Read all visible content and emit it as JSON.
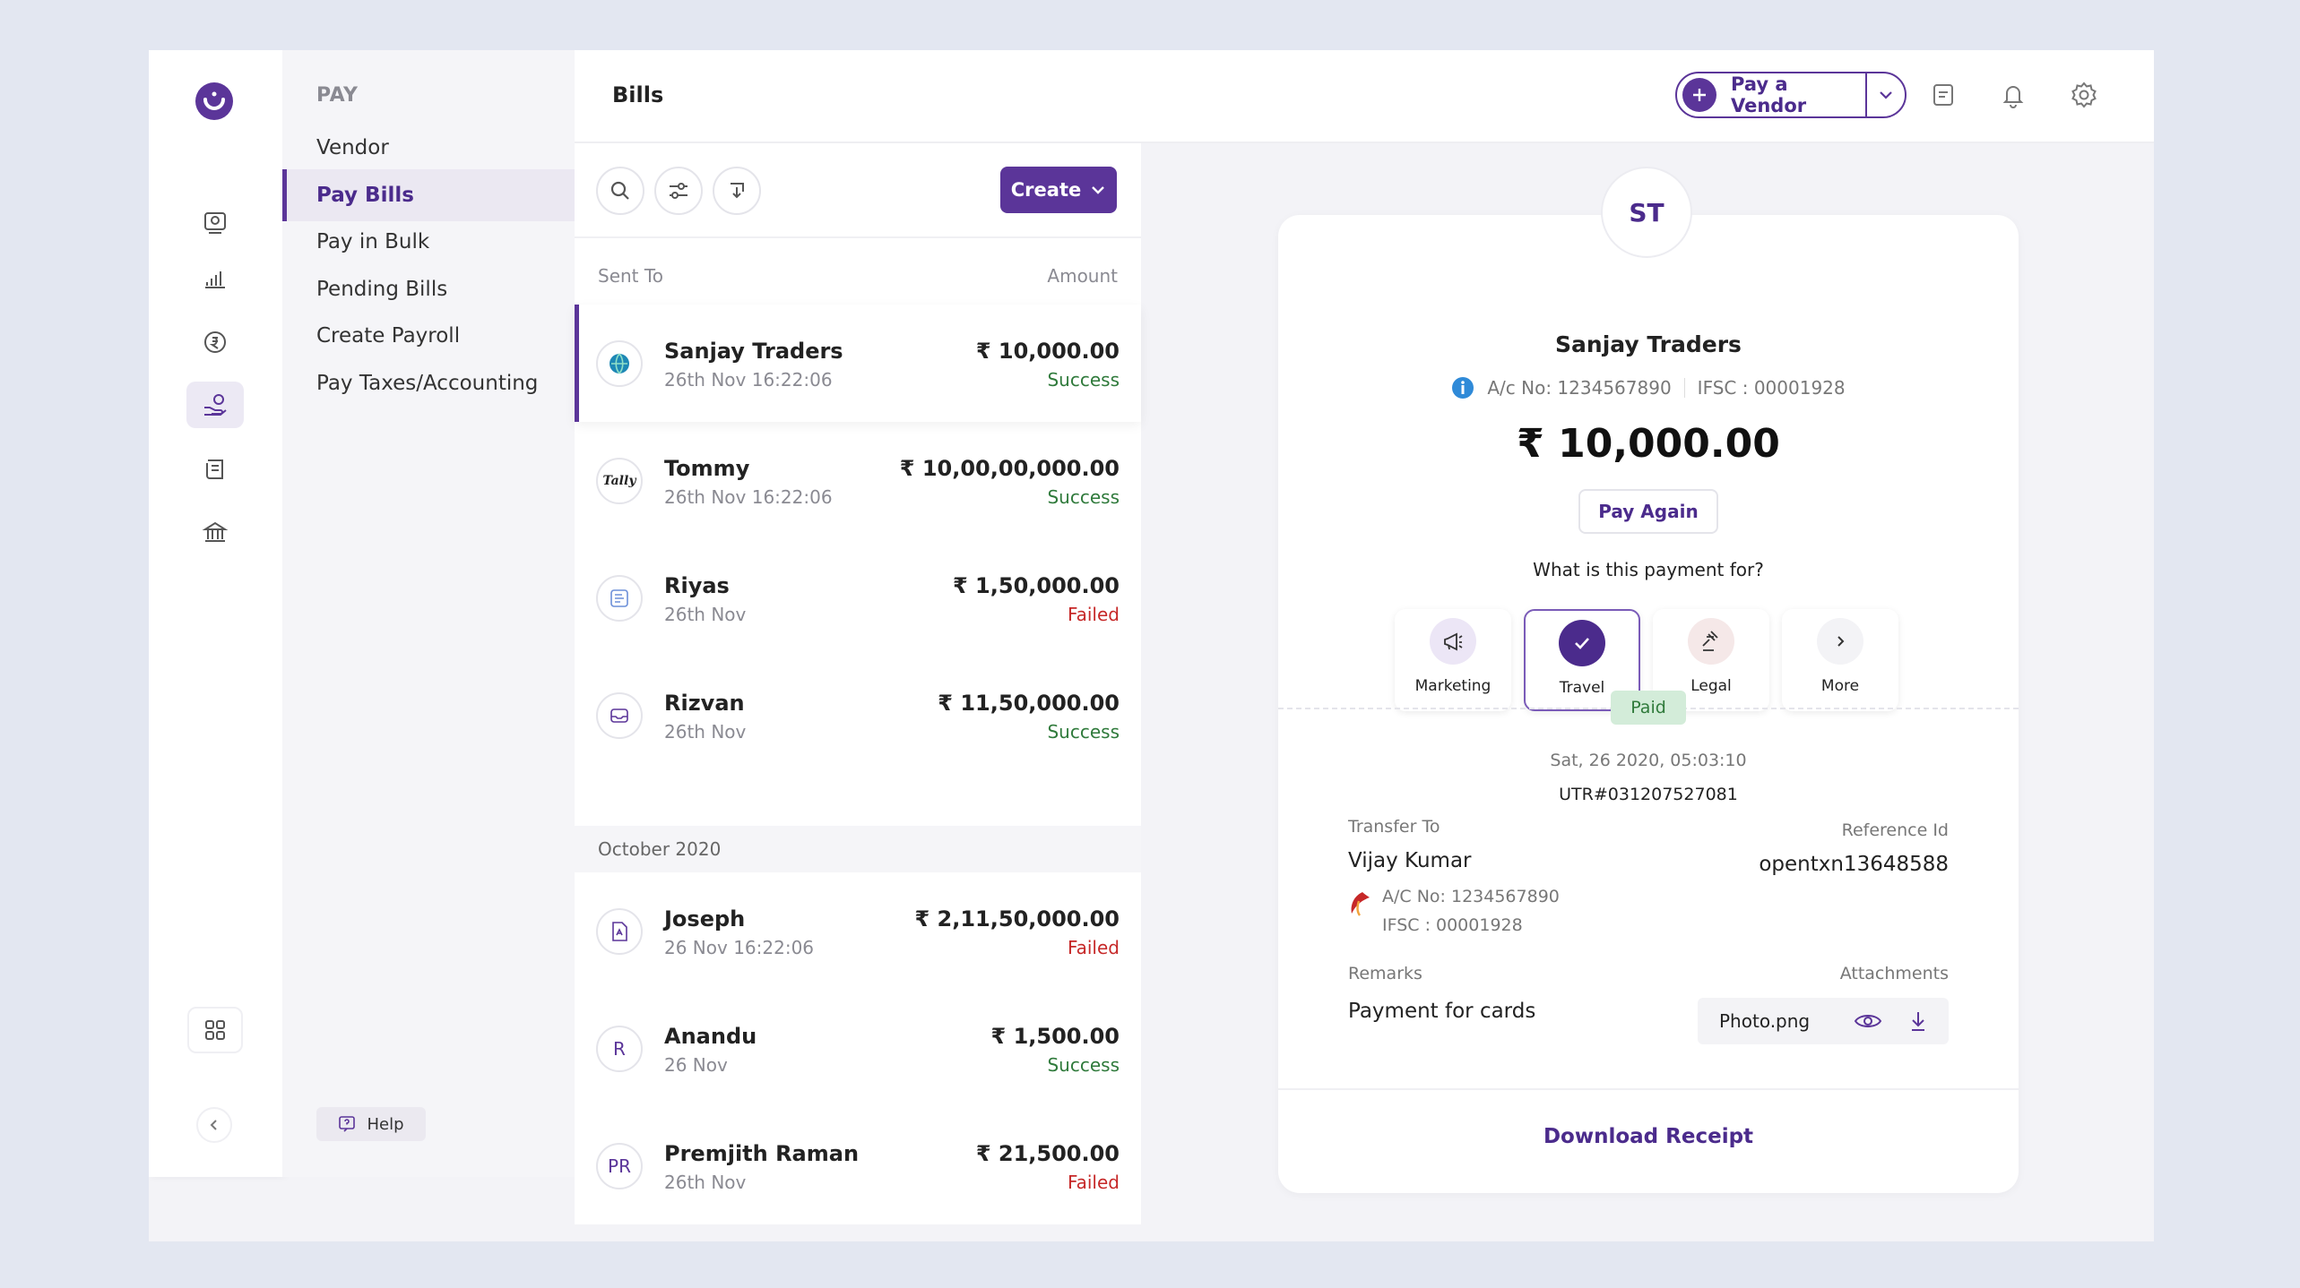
{
  "topbar": {
    "title": "Bills",
    "pay_vendor_label": "Pay a Vendor"
  },
  "menu": {
    "heading": "PAY",
    "items": [
      {
        "label": "Vendor"
      },
      {
        "label": "Pay Bills"
      },
      {
        "label": "Pay in Bulk"
      },
      {
        "label": "Pending Bills"
      },
      {
        "label": "Create Payroll"
      },
      {
        "label": "Pay Taxes/Accounting"
      }
    ],
    "help_label": "Help"
  },
  "list": {
    "create_label": "Create",
    "col_sent_to": "Sent To",
    "col_amount": "Amount",
    "month_label": "October 2020",
    "rows": [
      {
        "name": "Sanjay Traders",
        "date": "26th Nov 16:22:06",
        "amount": "₹ 10,000.00",
        "status": "Success",
        "avatar": ""
      },
      {
        "name": "Tommy",
        "date": "26th Nov 16:22:06",
        "amount": "₹ 10,00,00,000.00",
        "status": "Success",
        "avatar": "Tally"
      },
      {
        "name": "Riyas",
        "date": "26th Nov",
        "amount": "₹ 1,50,000.00",
        "status": "Failed",
        "avatar": ""
      },
      {
        "name": "Rizvan",
        "date": "26th Nov",
        "amount": "₹ 11,50,000.00",
        "status": "Success",
        "avatar": ""
      },
      {
        "name": "Joseph",
        "date": "26 Nov 16:22:06",
        "amount": "₹ 2,11,50,000.00",
        "status": "Failed",
        "avatar": ""
      },
      {
        "name": "Anandu",
        "date": "26 Nov",
        "amount": "₹ 1,500.00",
        "status": "Success",
        "avatar": "R"
      },
      {
        "name": "Premjith Raman",
        "date": "26th Nov",
        "amount": "₹ 21,500.00",
        "status": "Failed",
        "avatar": "PR"
      }
    ]
  },
  "detail": {
    "initials": "ST",
    "name": "Sanjay Traders",
    "account": "A/c No: 1234567890",
    "ifsc": "IFSC : 00001928",
    "amount": "₹ 10,000.00",
    "pay_again": "Pay Again",
    "question": "What is this payment for?",
    "purposes": [
      {
        "label": "Marketing",
        "icon": "megaphone-icon"
      },
      {
        "label": "Travel",
        "icon": "check-icon"
      },
      {
        "label": "Legal",
        "icon": "gavel-icon"
      },
      {
        "label": "More",
        "icon": "chevron-right-icon"
      }
    ],
    "status_badge": "Paid",
    "datetime": "Sat, 26 2020, 05:03:10",
    "utr": "UTR#031207527081",
    "transfer_to_label": "Transfer To",
    "transfer_to_name": "Vijay Kumar",
    "transfer_account": "A/C No: 1234567890",
    "transfer_ifsc": "IFSC : 00001928",
    "reference_label": "Reference Id",
    "reference_value": "opentxn13648588",
    "remarks_label": "Remarks",
    "remarks_value": "Payment for cards",
    "attachments_label": "Attachments",
    "attachment_name": "Photo.png",
    "download_label": "Download Receipt"
  },
  "colors": {
    "brand": "#5b3599",
    "success": "#2f7a3b",
    "failed": "#c62828"
  }
}
